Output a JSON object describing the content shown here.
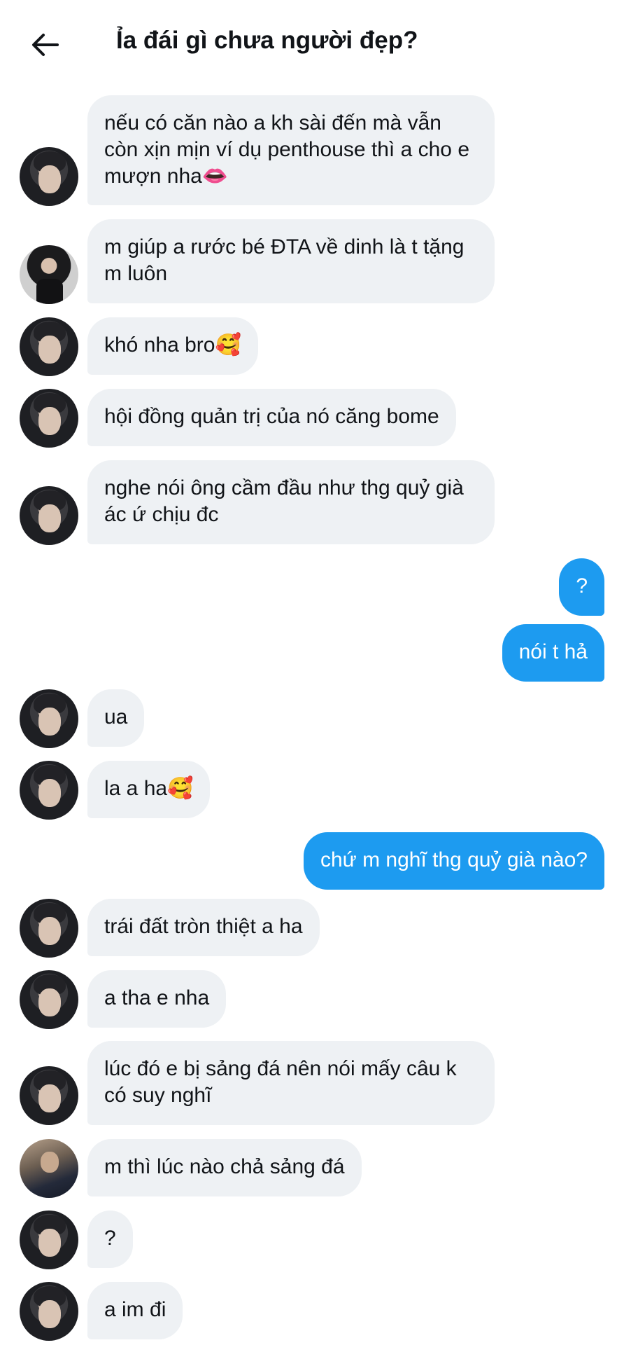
{
  "header": {
    "title": "Ỉa đái gì chưa người đẹp?",
    "back_icon": "arrow-left-icon"
  },
  "colors": {
    "incoming_bubble": "#eef1f4",
    "outgoing_bubble": "#1d9bf0",
    "text": "#111418"
  },
  "messages": [
    {
      "side": "in",
      "avatar": "a",
      "text": "nếu có căn nào a kh sài đến mà vẫn còn xịn mịn ví dụ penthouse thì a cho e mượn nha👄"
    },
    {
      "side": "in",
      "avatar": "b",
      "text": "m giúp a rước bé ĐTA về dinh là t tặng m luôn"
    },
    {
      "side": "in",
      "avatar": "a",
      "text": "khó nha bro🥰"
    },
    {
      "side": "in",
      "avatar": "a",
      "text": "hội đồng quản trị của nó căng bome"
    },
    {
      "side": "in",
      "avatar": "a",
      "text": "nghe nói ông cầm đầu như thg quỷ già ác ứ chịu đc"
    },
    {
      "side": "out",
      "text": "?"
    },
    {
      "side": "out",
      "text": "nói t hả"
    },
    {
      "side": "in",
      "avatar": "a",
      "text": "ua"
    },
    {
      "side": "in",
      "avatar": "a",
      "text": "la a ha🥰"
    },
    {
      "side": "out",
      "text": "chứ m nghĩ thg quỷ già nào?"
    },
    {
      "side": "in",
      "avatar": "a",
      "text": "trái đất tròn thiệt a ha"
    },
    {
      "side": "in",
      "avatar": "a",
      "text": "a tha e nha"
    },
    {
      "side": "in",
      "avatar": "a",
      "text": "lúc đó e bị sảng đá nên nói mấy câu k có suy nghĩ"
    },
    {
      "side": "in",
      "avatar": "c",
      "text": "m thì lúc nào chả sảng đá"
    },
    {
      "side": "in",
      "avatar": "a",
      "text": "?"
    },
    {
      "side": "in",
      "avatar": "a",
      "text": "a im đi"
    }
  ]
}
